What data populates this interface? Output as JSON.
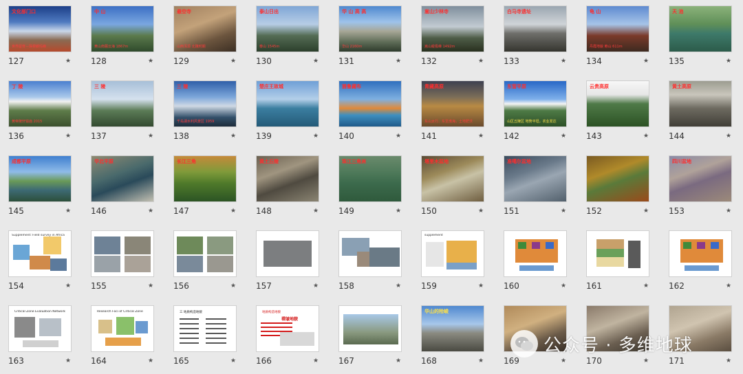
{
  "slides": [
    {
      "n": "127",
      "bg": "linear-gradient(180deg,#1c3f88 0%,#4f7ac0 35%,#c9d7ea 55%,#8a6a52 75%,#b64a2c 100%)",
      "title": "文化部门口",
      "cap": "世界屋脊—珠穆朗玛峰"
    },
    {
      "n": "128",
      "bg": "linear-gradient(180deg,#3c6fc4 0%,#7aa7e0 40%,#5b7a4c 65%,#2f4a2c 100%)",
      "title": "中 山",
      "cap": "黄山南麓云海  1867m"
    },
    {
      "n": "129",
      "bg": "linear-gradient(160deg,#a08060 0%,#c3a27a 40%,#6c553e 70%,#3c2f24 100%)",
      "title": "悬空寺",
      "cap": "山西浑源  北魏时期"
    },
    {
      "n": "130",
      "bg": "linear-gradient(180deg,#7fa6d6 0%,#b7cde6 40%,#546c54 65%,#2c3f2c 100%)",
      "title": "泰山日出",
      "cap": "泰山  1545m"
    },
    {
      "n": "131",
      "bg": "linear-gradient(180deg,#4e88cf 0%,#9ec3ea 35%,#a7a797 55%,#5c6a55 80%,#2e3b2c 100%)",
      "title": "华 山 高 高",
      "cap": "华山  2160m"
    },
    {
      "n": "132",
      "bg": "linear-gradient(180deg,#7f8e9c 0%,#c2cbd2 45%,#4f5d48 70%,#28301f 100%)",
      "title": "嵩山少林寺",
      "cap": "嵩山峻极峰 1492m"
    },
    {
      "n": "133",
      "bg": "linear-gradient(180deg,#9aa6b0 0%,#d0d4d8 40%,#6e6e6a 60%,#35352f 100%)",
      "title": "白马寺遗址",
      "cap": ""
    },
    {
      "n": "134",
      "bg": "linear-gradient(180deg,#5e8ad0 0%,#a6c4e8 40%,#7a3a2a 65%,#3d2a20 100%)",
      "title": "龟 山",
      "cap": "丹霞地貌  赖山  611m"
    },
    {
      "n": "135",
      "bg": "linear-gradient(180deg,#8bb27a 0%,#5f8f58 40%,#3e7a6a 60%,#2c5b4a 100%)",
      "title": "天 池",
      "cap": ""
    },
    {
      "n": "136",
      "bg": "linear-gradient(180deg,#4a7fcf 0%,#a9c8ea 35%,#f2f2f2 45%,#5e7c4a 65%,#3c4f2d 100%)",
      "title": "丁 陵",
      "cap": "黄帝陵轩辕庙  2015"
    },
    {
      "n": "137",
      "bg": "linear-gradient(180deg,#a7bfd8 0%,#d5e1ee 40%,#5b7b56 65%,#334a30 100%)",
      "title": "三 陵",
      "cap": ""
    },
    {
      "n": "138",
      "bg": "linear-gradient(180deg,#2f5fa8 0%,#7ca6da 35%,#cfd9e4 55%,#33506a 80%,#1d2c3a 100%)",
      "title": "三 陵",
      "cap": "千岛湖水利风景区  1959"
    },
    {
      "n": "139",
      "bg": "linear-gradient(180deg,#6f9fd6 0%,#b4cfe9 40%,#3b7ea0 60%,#245a78 100%)",
      "title": "楚庄王故城",
      "cap": ""
    },
    {
      "n": "140",
      "bg": "linear-gradient(180deg,#2f6fbe 0%,#7fb0e0 40%,#e08a3a 60%,#3f8fbf 75%,#1f5a8a 100%)",
      "title": "雅鲁藏布",
      "cap": ""
    },
    {
      "n": "141",
      "bg": "linear-gradient(180deg,#3d4050 0%,#7b6d58 35%,#b88a44 55%,#6a4a2c 100%)",
      "title": "青藏高原",
      "cap": "东山太行、东至渤海，土地肥沃"
    },
    {
      "n": "142",
      "bg": "linear-gradient(180deg,#2767c6 0%,#7fb0ea 40%,#f4f4f4 50%,#4e7a46 65%,#2c4f26 100%)",
      "title": "东营平原",
      "cap": "山区丘陵区  地势平坦，农业发达"
    },
    {
      "n": "143",
      "bg": "linear-gradient(180deg,#f7f7f7 0%,#e6e6e6 30%,#4f7a48 50%,#2c5224 100%)",
      "title": "云贵高原",
      "cap": ""
    },
    {
      "n": "144",
      "bg": "linear-gradient(180deg,#9c9c90 0%,#c9c6bc 30%,#6d6a60 60%,#413f38 100%)",
      "title": "黄土高原",
      "cap": ""
    },
    {
      "n": "145",
      "bg": "linear-gradient(180deg,#3f7fcf 0%,#8fbbe8 35%,#6a9a58 55%,#3d6a74 75%,#2c4f3a 100%)",
      "title": "成都平原",
      "cap": ""
    },
    {
      "n": "146",
      "bg": "linear-gradient(160deg,#8e8a72 0%,#4a6a6c 40%,#2a4a5a 60%,#c2c0b2 100%)",
      "title": "华北平原",
      "cap": ""
    },
    {
      "n": "147",
      "bg": "linear-gradient(180deg,#c58a3a 0%,#7f9a3a 35%,#4f7a2a 60%,#2c5424 100%)",
      "title": "长江三角",
      "cap": ""
    },
    {
      "n": "148",
      "bg": "linear-gradient(160deg,#6a6050 0%,#a09580 35%,#4f4a40 60%,#8a8472 100%)",
      "title": "黄土丘陵",
      "cap": ""
    },
    {
      "n": "149",
      "bg": "linear-gradient(180deg,#6a8a6c 0%,#4f7a5a 35%,#3c6a4c 60%,#2f5a3c 100%)",
      "title": "珠江三角洲",
      "cap": ""
    },
    {
      "n": "150",
      "bg": "linear-gradient(160deg,#5a4a34 0%,#9c8a5a 35%,#c8c2a6 55%,#6f5e40 100%)",
      "title": "塔里木盆地",
      "cap": ""
    },
    {
      "n": "151",
      "bg": "linear-gradient(160deg,#3a4a5c 0%,#6a7a8a 35%,#9aa6b2 55%,#52606c 100%)",
      "title": "准噶尔盆地",
      "cap": ""
    },
    {
      "n": "152",
      "bg": "linear-gradient(160deg,#7a5a22 0%,#b08a2a 35%,#5a7a3a 55%,#9a4a1a 100%)",
      "title": "",
      "cap": ""
    },
    {
      "n": "153",
      "bg": "linear-gradient(160deg,#8a8aa6 0%,#b0a29a 35%,#7a6a80 55%,#9c8a7a 100%)",
      "title": "四川盆地",
      "cap": ""
    }
  ],
  "row4": [
    {
      "n": "154",
      "heading": "Supplement: Field survey in Africa",
      "kind": "map"
    },
    {
      "n": "155",
      "kind": "photos4"
    },
    {
      "n": "156",
      "kind": "photos4b"
    },
    {
      "n": "157",
      "kind": "photo1"
    },
    {
      "n": "158",
      "kind": "photos3"
    },
    {
      "n": "159",
      "heading": "supplement",
      "kind": "diagram"
    },
    {
      "n": "160",
      "kind": "flow"
    },
    {
      "n": "161",
      "kind": "strata"
    },
    {
      "n": "162",
      "kind": "flow"
    }
  ],
  "row5": [
    {
      "n": "163",
      "heading": "Critical Zone Evaluation Network",
      "kind": "cz"
    },
    {
      "n": "164",
      "heading": "Research Foci of Critical Zone",
      "kind": "foci"
    },
    {
      "n": "165",
      "heading": "三 地质构造地貌",
      "kind": "textlist"
    },
    {
      "n": "166",
      "heading": "地质构造地貌",
      "sub": "褶皱地貌",
      "kind": "fold"
    },
    {
      "n": "167",
      "heading": "",
      "kind": "photoslide"
    },
    {
      "n": "168",
      "title": "华山的险峻",
      "kind": "photo"
    },
    {
      "n": "169",
      "kind": "photo"
    },
    {
      "n": "170",
      "kind": "photo"
    },
    {
      "n": "171",
      "kind": "photo"
    }
  ],
  "watermark": {
    "text": "公众号 · 多维地球",
    "icon": "wechat-icon"
  },
  "star_glyph": "★"
}
